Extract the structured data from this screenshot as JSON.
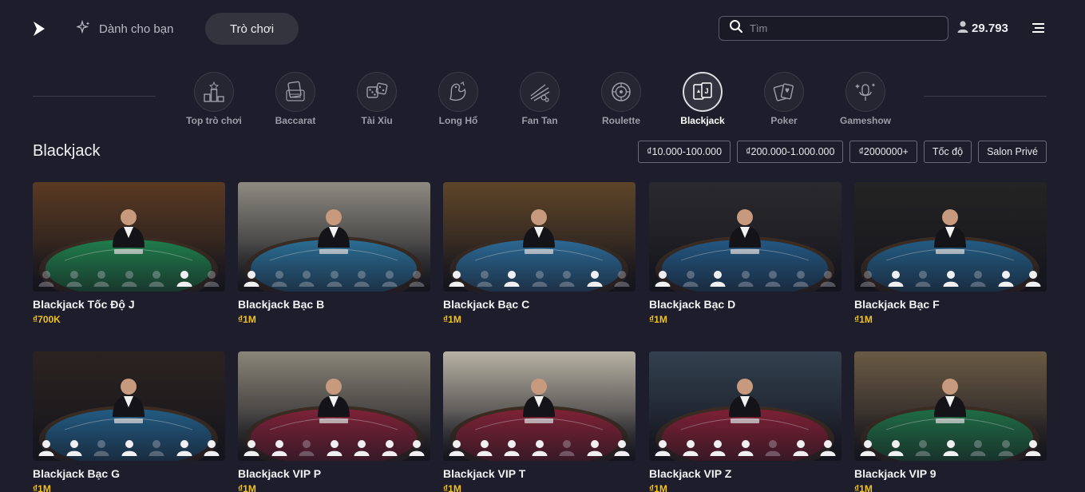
{
  "header": {
    "nav_foryou": "Dành cho bạn",
    "nav_games": "Trò chơi",
    "search_placeholder": "Tìm",
    "balance": "29.793"
  },
  "categories": [
    {
      "label": "Top trò chơi",
      "icon": "top-games-icon"
    },
    {
      "label": "Baccarat",
      "icon": "baccarat-icon"
    },
    {
      "label": "Tài Xỉu",
      "icon": "dice-icon"
    },
    {
      "label": "Long Hổ",
      "icon": "dragon-tiger-icon"
    },
    {
      "label": "Fan Tan",
      "icon": "fan-tan-icon"
    },
    {
      "label": "Roulette",
      "icon": "roulette-icon"
    },
    {
      "label": "Blackjack",
      "icon": "blackjack-icon",
      "active": true
    },
    {
      "label": "Poker",
      "icon": "poker-icon"
    },
    {
      "label": "Gameshow",
      "icon": "gameshow-icon"
    }
  ],
  "section": {
    "title": "Blackjack",
    "filters": [
      "₫10.000-100.000",
      "₫200.000-1.000.000",
      "₫2000000+",
      "Tốc độ",
      "Salon Privé"
    ]
  },
  "games": [
    {
      "name": "Blackjack Tốc Độ J",
      "bet": "₫700K",
      "felt": "#1f7a4a",
      "bg": "#5a3a22",
      "seats_taken": [
        5
      ]
    },
    {
      "name": "Blackjack Bạc B",
      "bet": "₫1M",
      "felt": "#2a6a90",
      "bg": "#8c8a80",
      "seats_taken": [
        0
      ]
    },
    {
      "name": "Blackjack Bạc C",
      "bet": "₫1M",
      "felt": "#2b6690",
      "bg": "#5e4528",
      "seats_taken": [
        0,
        2,
        5
      ]
    },
    {
      "name": "Blackjack Bạc D",
      "bet": "₫1M",
      "felt": "#23557e",
      "bg": "#2a2a2e",
      "seats_taken": [
        0,
        2
      ]
    },
    {
      "name": "Blackjack Bạc F",
      "bet": "₫1M",
      "felt": "#235a80",
      "bg": "#242424",
      "seats_taken": [
        1,
        3,
        5,
        6
      ]
    },
    {
      "name": "Blackjack Bạc G",
      "bet": "₫1M",
      "felt": "#22597f",
      "bg": "#2b2320",
      "seats_taken": [
        0,
        1,
        3,
        5,
        6
      ]
    },
    {
      "name": "Blackjack VIP P",
      "bet": "₫1M",
      "felt": "#7a2237",
      "bg": "#8a8578",
      "seats_taken": [
        0,
        1,
        3,
        4,
        5,
        6
      ]
    },
    {
      "name": "Blackjack VIP T",
      "bet": "₫1M",
      "felt": "#7b2235",
      "bg": "#b8b2a4",
      "seats_taken": [
        0,
        1,
        2,
        3,
        5,
        6
      ]
    },
    {
      "name": "Blackjack VIP Z",
      "bet": "₫1M",
      "felt": "#7a2034",
      "bg": "#32404f",
      "seats_taken": [
        0,
        1,
        2,
        3,
        5,
        6
      ]
    },
    {
      "name": "Blackjack VIP 9",
      "bet": "₫1M",
      "felt": "#1f6a44",
      "bg": "#6a5a44",
      "seats_taken": [
        0,
        1,
        3,
        6
      ]
    }
  ]
}
